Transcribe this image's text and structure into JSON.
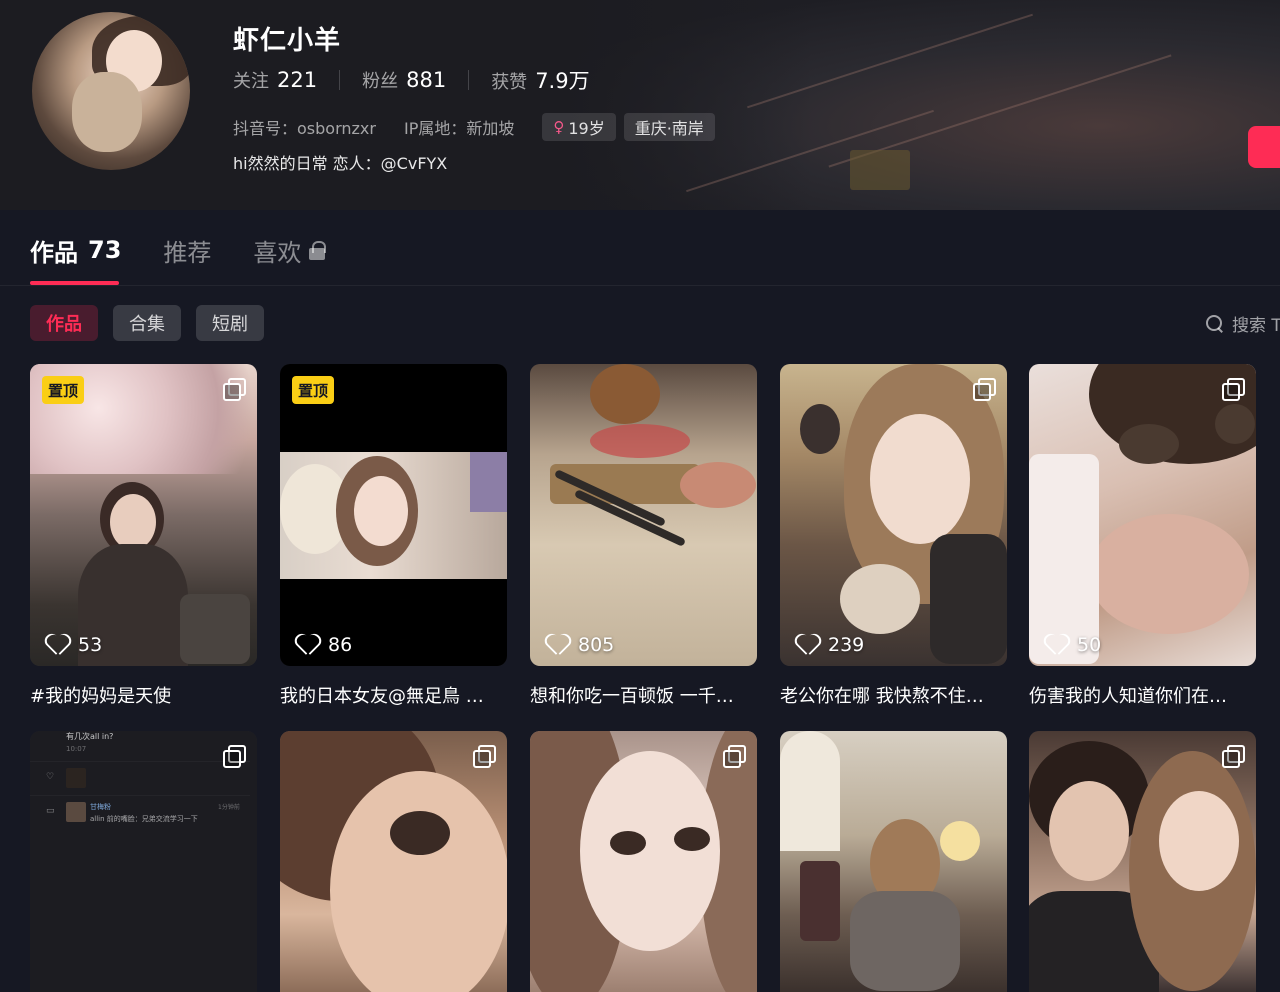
{
  "profile": {
    "username": "虾仁小羊",
    "following_label": "关注",
    "following_count": "221",
    "followers_label": "粉丝",
    "followers_count": "881",
    "likes_label": "获赞",
    "likes_count": "7.9万",
    "douyin_id": "抖音号：osbornzxr",
    "ip_location": "IP属地：新加坡",
    "age_tag": "19岁",
    "location_tag": "重庆·南岸",
    "bio": "hi然然的日常 恋人：@CvFYX"
  },
  "tabs": [
    {
      "label": "作品",
      "count": "73"
    },
    {
      "label": "推荐"
    },
    {
      "label": "喜欢"
    }
  ],
  "filters": [
    "作品",
    "合集",
    "短剧"
  ],
  "search": {
    "label": "搜索 T"
  },
  "pinned_label": "置顶",
  "videos": [
    {
      "likes": "53",
      "caption": "#我的妈妈是天使",
      "pinned": true,
      "multi": true
    },
    {
      "likes": "86",
      "caption": "我的日本女友@無足鳥 …",
      "pinned": true,
      "multi": false
    },
    {
      "likes": "805",
      "caption": "想和你吃一百顿饭 一千…",
      "pinned": false,
      "multi": false
    },
    {
      "likes": "239",
      "caption": "老公你在哪 我快熬不住…",
      "pinned": false,
      "multi": true
    },
    {
      "likes": "50",
      "caption": "伤害我的人知道你们在…",
      "pinned": false,
      "multi": true
    },
    {
      "multi": true
    },
    {
      "multi": true
    },
    {
      "multi": true
    },
    {
      "multi": false
    },
    {
      "multi": true
    }
  ],
  "chat_card": {
    "title": "有几次all in?",
    "time": "10:07",
    "name": "甘梅粉",
    "msg": "allin 前的嘴脸：兄弟交流学习一下",
    "ago": "1分钟前"
  },
  "colors": {
    "accent": "#fe2c55",
    "pin": "#face15",
    "background": "#161823"
  }
}
